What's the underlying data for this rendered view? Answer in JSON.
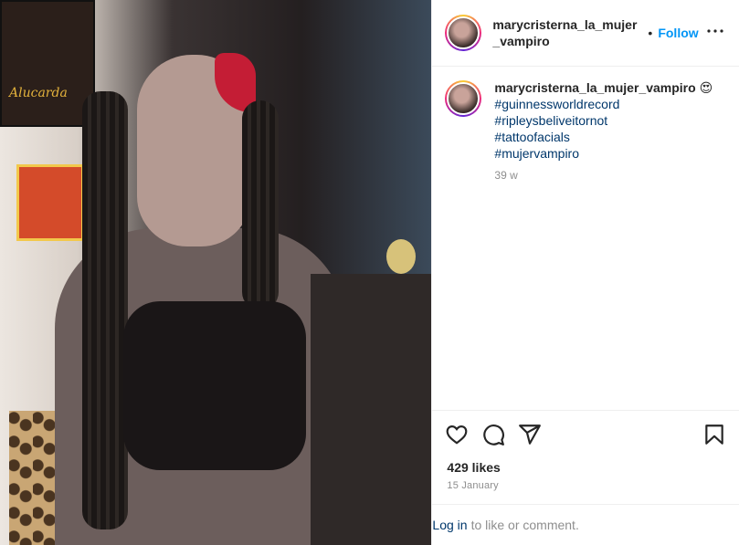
{
  "post": {
    "author": "marycristerna_la_mujer_vampiro",
    "header_username": "marycristerna_la_mujer_vampiro",
    "follow_label": "Follow",
    "dot": "•",
    "more_icon": "more-options-icon",
    "caption": {
      "emoji": "😍",
      "hashtags": [
        "#guinnessworldrecord",
        "#ripleysbeliveitornot",
        "#tattoofacials",
        "#mujervampiro"
      ],
      "age": "39 w"
    },
    "photo": {
      "poster_text": "Alucarda"
    },
    "likes": "429 likes",
    "date": "15 January",
    "login": {
      "link": "Log in",
      "text": "to like or comment."
    }
  }
}
